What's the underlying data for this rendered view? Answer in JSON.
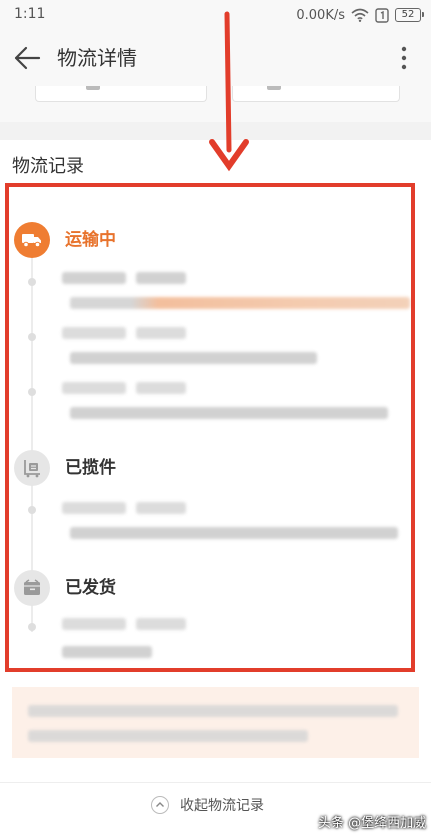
{
  "status_bar": {
    "time": "1:11",
    "net_speed": "0.00K/s",
    "battery": "52",
    "icons": [
      "wifi-icon",
      "sim-icon",
      "battery-icon"
    ]
  },
  "header": {
    "title": "物流详情",
    "back_icon": "back-arrow-icon",
    "menu_icon": "more-vertical-icon"
  },
  "section": {
    "title": "物流记录"
  },
  "timeline": [
    {
      "label": "运输中",
      "icon": "truck-icon",
      "active": true
    },
    {
      "label": "已揽件",
      "icon": "pickup-icon",
      "active": false
    },
    {
      "label": "已发货",
      "icon": "package-icon",
      "active": false
    }
  ],
  "collapse": {
    "label": "收起物流记录",
    "icon": "chevron-up-icon"
  },
  "watermark": {
    "text": "头条 @堡绛西加威"
  },
  "colors": {
    "accent_orange": "#ef7d32",
    "annotation_red": "#e23d2b",
    "notice_background": "#fdf0e8",
    "inactive_node": "#e6e6e6"
  }
}
